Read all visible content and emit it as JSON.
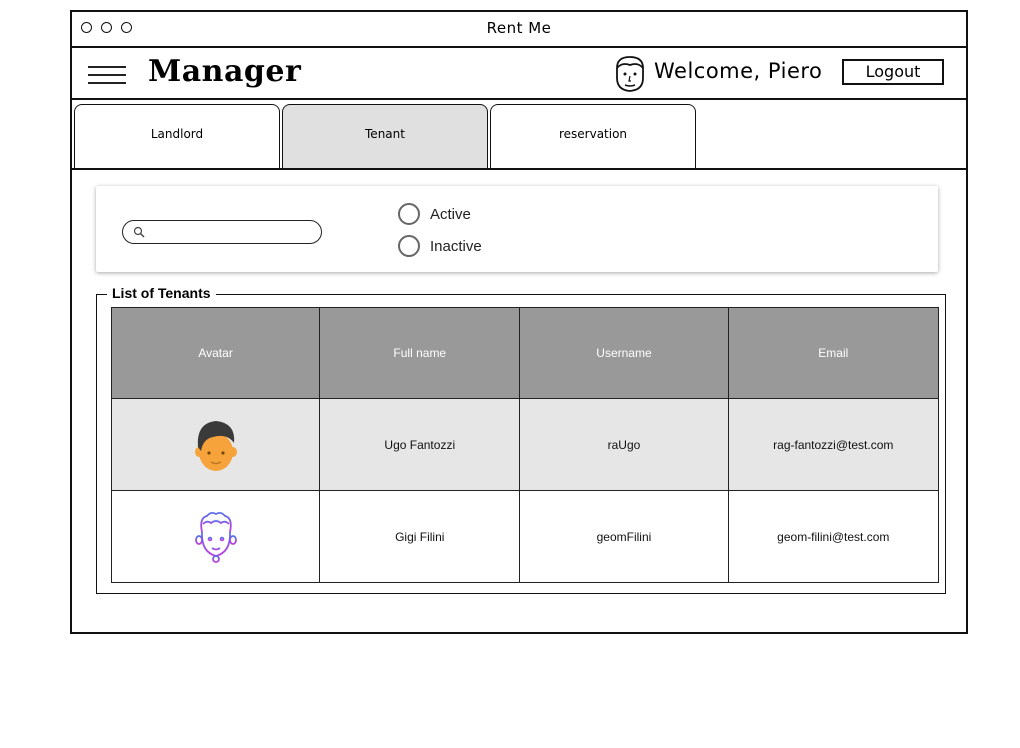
{
  "window": {
    "title": "Rent Me"
  },
  "header": {
    "brand": "Manager",
    "welcome": "Welcome, Piero",
    "logout_label": "Logout"
  },
  "tabs": [
    {
      "label": "Landlord",
      "active": false
    },
    {
      "label": "Tenant",
      "active": true
    },
    {
      "label": "reservation",
      "active": false
    }
  ],
  "filters": {
    "search": {
      "value": "",
      "placeholder": ""
    },
    "radios": [
      {
        "label": "Active",
        "checked": false
      },
      {
        "label": "Inactive",
        "checked": false
      }
    ]
  },
  "tenants": {
    "legend": "List of Tenants",
    "columns": [
      "Avatar",
      "Full name",
      "Username",
      "Email"
    ],
    "rows": [
      {
        "avatar_icon": "man-avatar-icon",
        "full_name": "Ugo Fantozzi",
        "username": "raUgo",
        "email": "rag-fantozzi@test.com"
      },
      {
        "avatar_icon": "curly-hair-avatar-icon",
        "full_name": "Gigi Filini",
        "username": "geomFilini",
        "email": "geom-filini@test.com"
      }
    ]
  },
  "colors": {
    "header_bg": "#999999",
    "active_tab_bg": "#e0e0e0",
    "shaded_row_bg": "#e6e6e6",
    "avatar_skin": "#f5a33a",
    "avatar_hair": "#3a3a3a",
    "outline_avatar": "#7b4fe0"
  }
}
